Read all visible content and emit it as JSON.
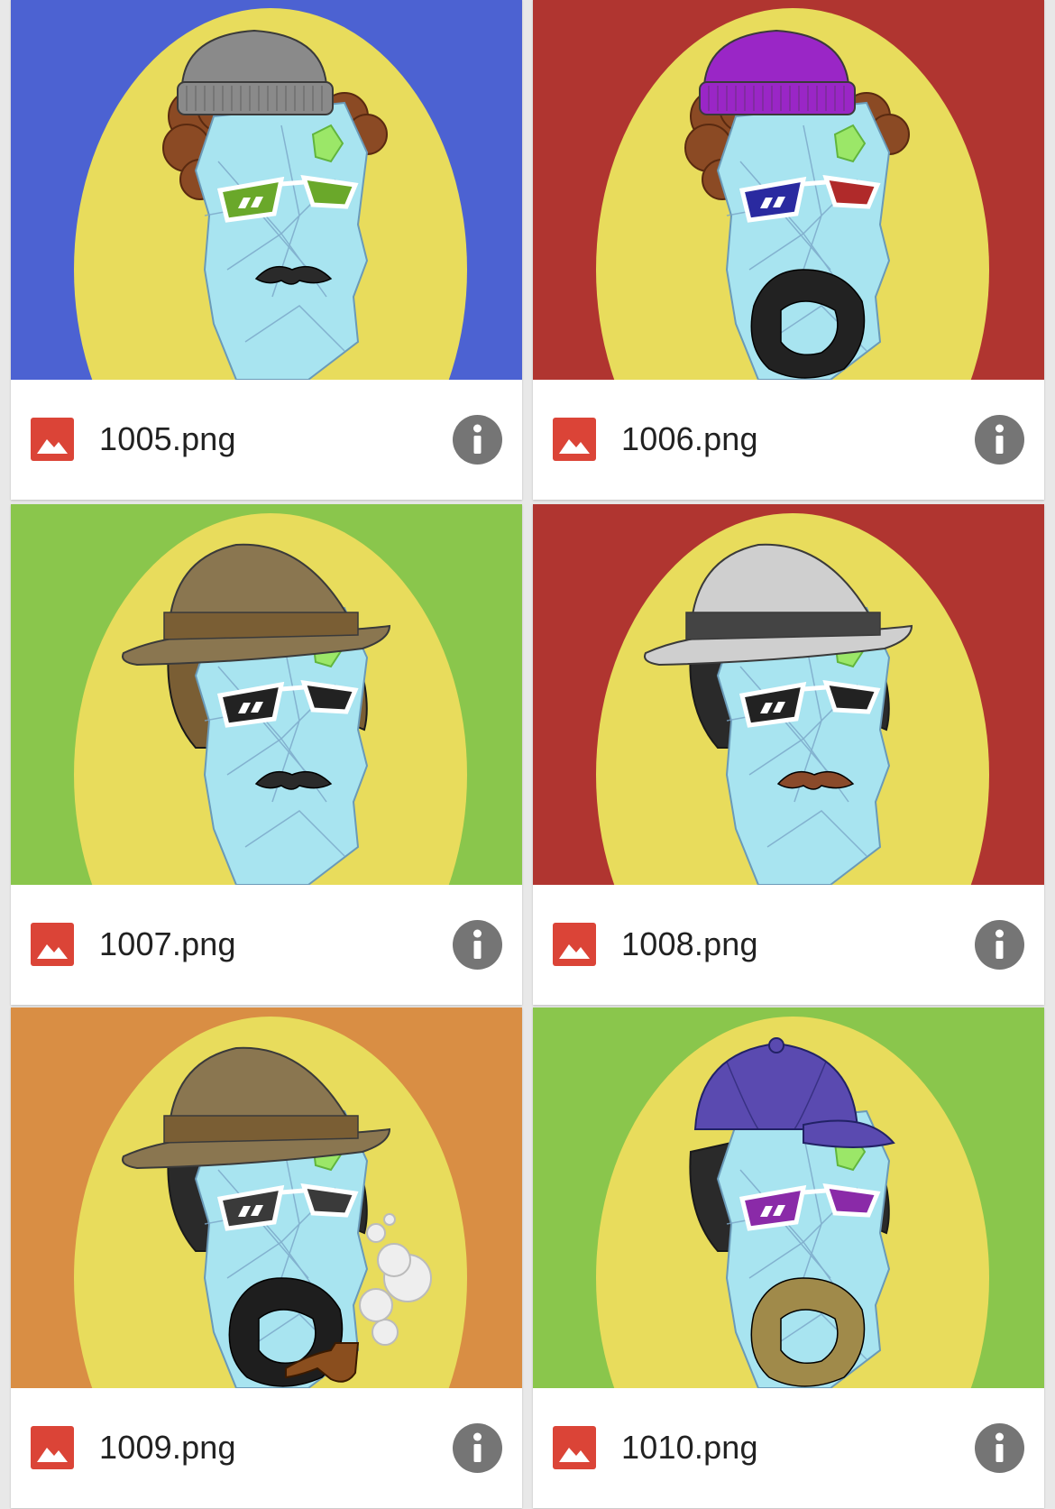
{
  "files": [
    {
      "name": "1005.png",
      "bg": "#4c62d2",
      "hat": "beanie",
      "hat_color": "#8a8a8a",
      "hair": "curly",
      "hair_color": "#8b4a24",
      "glasses_left": "#6aa82a",
      "glasses_right": "#6aa82a",
      "facial": "mustache",
      "facial_color": "#2a2a2a",
      "pipe": false
    },
    {
      "name": "1006.png",
      "bg": "#b03530",
      "hat": "beanie",
      "hat_color": "#9a26c6",
      "hair": "curly",
      "hair_color": "#8b4a24",
      "glasses_left": "#2a2aa0",
      "glasses_right": "#b02a2a",
      "facial": "beard",
      "facial_color": "#222222",
      "pipe": false
    },
    {
      "name": "1007.png",
      "bg": "#8ac64c",
      "hat": "fedora",
      "hat_color": "#8a7650",
      "hair": "side",
      "hair_color": "#7a5e34",
      "glasses_left": "#222222",
      "glasses_right": "#222222",
      "facial": "mustache",
      "facial_color": "#2a2a2a",
      "pipe": false
    },
    {
      "name": "1008.png",
      "bg": "#b03530",
      "hat": "fedora",
      "hat_color": "#cfcfcf",
      "hair": "side",
      "hair_color": "#2a2a2a",
      "glasses_left": "#222222",
      "glasses_right": "#222222",
      "facial": "mustache",
      "facial_color": "#8a4a2a",
      "pipe": false
    },
    {
      "name": "1009.png",
      "bg": "#d98e44",
      "hat": "fedora",
      "hat_color": "#8a7650",
      "hair": "side",
      "hair_color": "#2a2a2a",
      "glasses_left": "#3a3a3a",
      "glasses_right": "#3a3a3a",
      "facial": "beard",
      "facial_color": "#1e1e1e",
      "pipe": true
    },
    {
      "name": "1010.png",
      "bg": "#8ac64c",
      "hat": "cap",
      "hat_color": "#5a4ab0",
      "hair": "side",
      "hair_color": "#2a2a2a",
      "glasses_left": "#8a2aa8",
      "glasses_right": "#8a2aa8",
      "facial": "beard",
      "facial_color": "#a08a4a",
      "pipe": false
    }
  ],
  "icons": {
    "file_type": "image-file-icon",
    "info": "info-icon"
  },
  "colors": {
    "file_icon": "#db4437",
    "oval": "#e8dc5c",
    "face": "#a8e4f0",
    "info_bg": "#757575"
  }
}
